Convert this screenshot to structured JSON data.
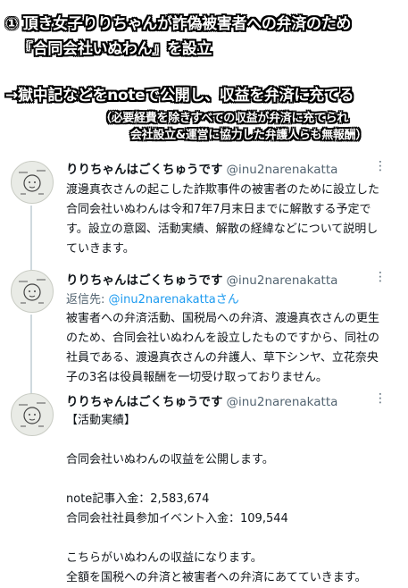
{
  "banner": {
    "line1": "① 頂き女子りりちゃんが詐偽被害者への弁済のため",
    "line2": "『合同会社いぬわん』を設立",
    "line3": "→獄中記などをnoteで公開し、収益を弁済に充てる",
    "line4": "（必要経費を除きすべての収益が弁済に充てられ",
    "line5": "会社設立&運営に協力した弁護人らも無報酬）"
  },
  "tweets": [
    {
      "name": "りりちゃんはごくちゅうです",
      "handle": "@inu2narenakatta",
      "more": "⋮",
      "body": "渡邊真衣さんの起こした詐欺事件の被害者のために設立した合同会社いぬわんは令和7年7月末日までに解散する予定です。設立の意図、活動実績、解散の経緯などについて説明していきます。"
    },
    {
      "name": "りりちゃんはごくちゅうです",
      "handle": "@inu2narenakatta",
      "more": "⋮",
      "reply_prefix": "返信先: ",
      "reply_mention": "@inu2narenakattaさん",
      "body": "被害者への弁済活動、国税局への弁済、渡邊真衣さんの更生のため、合同会社いぬわんを設立したものですから、同社の社員である、渡邊真衣さんの弁護人、草下シンヤ、立花奈央子の3名は役員報酬を一切受け取っておりません。"
    },
    {
      "name": "りりちゃんはごくちゅうです",
      "handle": "@inu2narenakatta",
      "more": "⋮",
      "body": "【活動実績】\n\n合同会社いぬわんの収益を公開します。\n\nnote記事入金：2,583,674\n合同会社社員参加イベント入金：109,544\n\nこちらがいぬわんの収益になります。\n全額を国税への弁済と被害者への弁済にあてていきます。"
    }
  ]
}
